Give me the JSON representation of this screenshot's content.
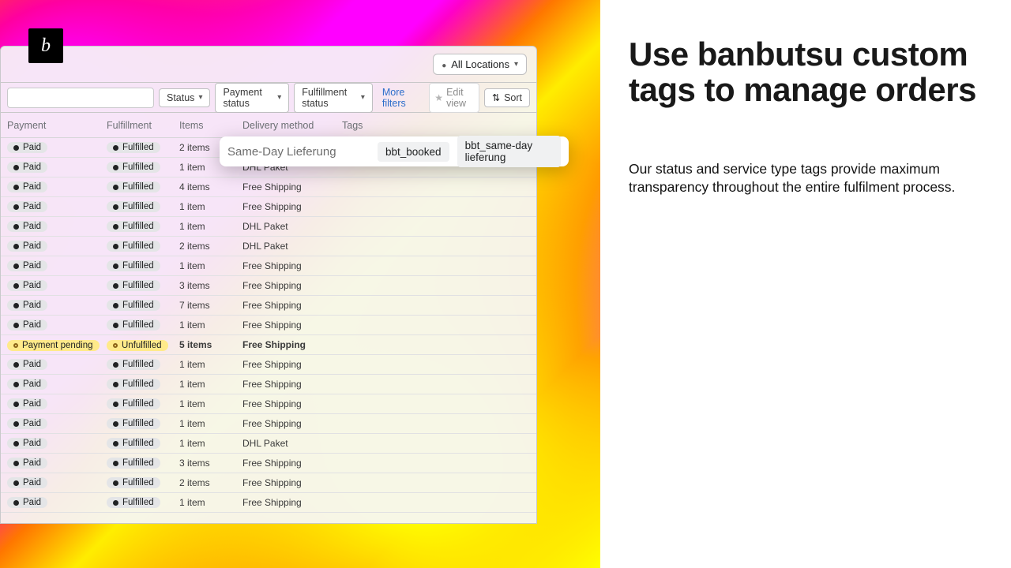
{
  "logo_glyph": "b",
  "locations_label": "All Locations",
  "filters": {
    "status": "Status",
    "payment_status": "Payment status",
    "fulfillment_status": "Fulfillment status",
    "more": "More filters",
    "edit_view": "Edit view",
    "sort": "Sort"
  },
  "headers": {
    "payment": "Payment",
    "fulfillment": "Fulfillment",
    "items": "Items",
    "delivery": "Delivery method",
    "tags": "Tags"
  },
  "callout": {
    "label": "Same-Day Lieferung",
    "chips": [
      "bbt_booked",
      "bbt_same-day lieferung"
    ]
  },
  "rows": [
    {
      "payment": "Paid",
      "pay_kind": "solid",
      "fulfillment": "Fulfilled",
      "ful_kind": "solid",
      "items": "2 items",
      "delivery": ""
    },
    {
      "payment": "Paid",
      "pay_kind": "solid",
      "fulfillment": "Fulfilled",
      "ful_kind": "solid",
      "items": "1 item",
      "delivery": "DHL Paket"
    },
    {
      "payment": "Paid",
      "pay_kind": "solid",
      "fulfillment": "Fulfilled",
      "ful_kind": "solid",
      "items": "4 items",
      "delivery": "Free Shipping"
    },
    {
      "payment": "Paid",
      "pay_kind": "solid",
      "fulfillment": "Fulfilled",
      "ful_kind": "solid",
      "items": "1 item",
      "delivery": "Free Shipping"
    },
    {
      "payment": "Paid",
      "pay_kind": "solid",
      "fulfillment": "Fulfilled",
      "ful_kind": "solid",
      "items": "1 item",
      "delivery": "DHL Paket"
    },
    {
      "payment": "Paid",
      "pay_kind": "solid",
      "fulfillment": "Fulfilled",
      "ful_kind": "solid",
      "items": "2 items",
      "delivery": "DHL Paket"
    },
    {
      "payment": "Paid",
      "pay_kind": "solid",
      "fulfillment": "Fulfilled",
      "ful_kind": "solid",
      "items": "1 item",
      "delivery": "Free Shipping"
    },
    {
      "payment": "Paid",
      "pay_kind": "solid",
      "fulfillment": "Fulfilled",
      "ful_kind": "solid",
      "items": "3 items",
      "delivery": "Free Shipping"
    },
    {
      "payment": "Paid",
      "pay_kind": "solid",
      "fulfillment": "Fulfilled",
      "ful_kind": "solid",
      "items": "7 items",
      "delivery": "Free Shipping"
    },
    {
      "payment": "Paid",
      "pay_kind": "solid",
      "fulfillment": "Fulfilled",
      "ful_kind": "solid",
      "items": "1 item",
      "delivery": "Free Shipping"
    },
    {
      "payment": "Payment pending",
      "pay_kind": "warn",
      "fulfillment": "Unfulfilled",
      "ful_kind": "warn",
      "items": "5 items",
      "delivery": "Free Shipping",
      "pending": true
    },
    {
      "payment": "Paid",
      "pay_kind": "solid",
      "fulfillment": "Fulfilled",
      "ful_kind": "solid",
      "items": "1 item",
      "delivery": "Free Shipping"
    },
    {
      "payment": "Paid",
      "pay_kind": "solid",
      "fulfillment": "Fulfilled",
      "ful_kind": "solid",
      "items": "1 item",
      "delivery": "Free Shipping"
    },
    {
      "payment": "Paid",
      "pay_kind": "solid",
      "fulfillment": "Fulfilled",
      "ful_kind": "solid",
      "items": "1 item",
      "delivery": "Free Shipping"
    },
    {
      "payment": "Paid",
      "pay_kind": "solid",
      "fulfillment": "Fulfilled",
      "ful_kind": "solid",
      "items": "1 item",
      "delivery": "Free Shipping"
    },
    {
      "payment": "Paid",
      "pay_kind": "solid",
      "fulfillment": "Fulfilled",
      "ful_kind": "solid",
      "items": "1 item",
      "delivery": "DHL Paket"
    },
    {
      "payment": "Paid",
      "pay_kind": "solid",
      "fulfillment": "Fulfilled",
      "ful_kind": "solid",
      "items": "3 items",
      "delivery": "Free Shipping"
    },
    {
      "payment": "Paid",
      "pay_kind": "solid",
      "fulfillment": "Fulfilled",
      "ful_kind": "solid",
      "items": "2 items",
      "delivery": "Free Shipping"
    },
    {
      "payment": "Paid",
      "pay_kind": "solid",
      "fulfillment": "Fulfilled",
      "ful_kind": "solid",
      "items": "1 item",
      "delivery": "Free Shipping"
    }
  ],
  "copy": {
    "headline": "Use banbutsu custom tags to manage orders",
    "body": "Our status and service type tags provide maximum transparency throughout the entire fulfilment process."
  }
}
